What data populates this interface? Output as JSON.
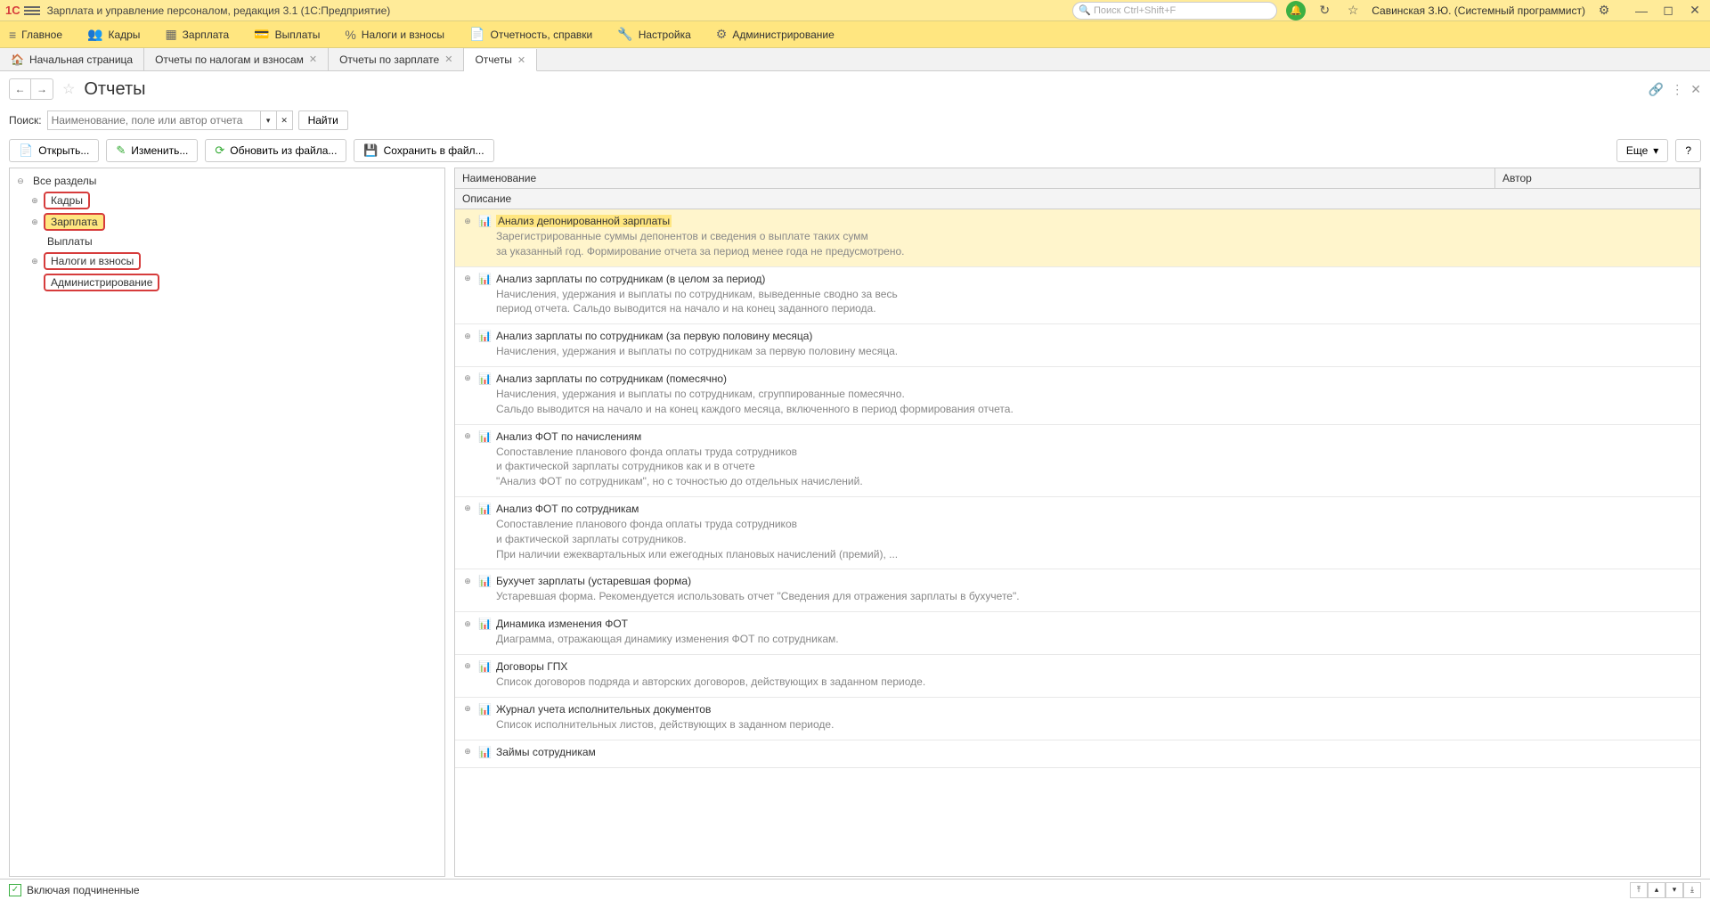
{
  "titlebar": {
    "logo": "1C",
    "app_title": "Зарплата и управление персоналом, редакция 3.1  (1С:Предприятие)",
    "search_placeholder": "Поиск Ctrl+Shift+F",
    "user": "Савинская З.Ю. (Системный программист)"
  },
  "mainmenu": [
    {
      "icon": "≡",
      "label": "Главное"
    },
    {
      "icon": "👥",
      "label": "Кадры"
    },
    {
      "icon": "▦",
      "label": "Зарплата"
    },
    {
      "icon": "💳",
      "label": "Выплаты"
    },
    {
      "icon": "%",
      "label": "Налоги и взносы"
    },
    {
      "icon": "📄",
      "label": "Отчетность, справки"
    },
    {
      "icon": "🔧",
      "label": "Настройка"
    },
    {
      "icon": "⚙",
      "label": "Администрирование"
    }
  ],
  "tabs": [
    {
      "icon": "🏠",
      "label": "Начальная страница",
      "closable": false
    },
    {
      "icon": "",
      "label": "Отчеты по налогам и взносам",
      "closable": true
    },
    {
      "icon": "",
      "label": "Отчеты по зарплате",
      "closable": true
    },
    {
      "icon": "",
      "label": "Отчеты",
      "closable": true,
      "active": true
    }
  ],
  "page": {
    "title": "Отчеты",
    "search_label": "Поиск:",
    "search_placeholder": "Наименование, поле или автор отчета",
    "find_button": "Найти"
  },
  "toolbar": {
    "open": "Открыть...",
    "edit": "Изменить...",
    "update": "Обновить из файла...",
    "save": "Сохранить в файл...",
    "more": "Еще"
  },
  "tree": {
    "root": "Все разделы",
    "items": [
      {
        "label": "Кадры",
        "highlighted": true,
        "expandable": true
      },
      {
        "label": "Зарплата",
        "highlighted": true,
        "selected": true,
        "expandable": true
      },
      {
        "label": "Выплаты",
        "highlighted": false,
        "expandable": false
      },
      {
        "label": "Налоги и взносы",
        "highlighted": true,
        "expandable": true
      },
      {
        "label": "Администрирование",
        "highlighted": true,
        "expandable": false
      }
    ]
  },
  "table_headers": {
    "name": "Наименование",
    "author": "Автор",
    "description": "Описание"
  },
  "reports": [
    {
      "title": "Анализ депонированной зарплаты",
      "desc": "Зарегистрированные суммы депонентов и сведения о выплате таких сумм\nза указанный год. Формирование отчета за период менее года не предусмотрено.",
      "selected": true
    },
    {
      "title": "Анализ зарплаты по сотрудникам (в целом за период)",
      "desc": "Начисления, удержания и выплаты по сотрудникам, выведенные сводно за весь\nпериод отчета. Сальдо выводится на начало и на конец заданного периода."
    },
    {
      "title": "Анализ зарплаты по сотрудникам (за первую половину месяца)",
      "desc": "Начисления, удержания и выплаты по сотрудникам за первую половину месяца."
    },
    {
      "title": "Анализ зарплаты по сотрудникам (помесячно)",
      "desc": "Начисления, удержания и выплаты по сотрудникам, сгруппированные помесячно.\nСальдо выводится на начало и на конец каждого месяца, включенного в период формирования отчета."
    },
    {
      "title": "Анализ ФОТ по начислениям",
      "desc": "Сопоставление планового фонда оплаты труда сотрудников\nи фактической зарплаты сотрудников как и в отчете\n\"Анализ ФОТ по сотрудникам\", но с точностью до отдельных начислений."
    },
    {
      "title": "Анализ ФОТ по сотрудникам",
      "desc": "Сопоставление планового фонда оплаты труда сотрудников\nи фактической зарплаты сотрудников.\nПри наличии ежеквартальных или ежегодных плановых начислений (премий), ..."
    },
    {
      "title": "Бухучет зарплаты (устаревшая форма)",
      "desc": "Устаревшая форма. Рекомендуется использовать отчет \"Сведения для отражения зарплаты в бухучете\"."
    },
    {
      "title": "Динамика изменения ФОТ",
      "desc": "Диаграмма, отражающая динамику изменения ФОТ по сотрудникам."
    },
    {
      "title": "Договоры ГПХ",
      "desc": "Список договоров подряда и авторских договоров, действующих в заданном периоде."
    },
    {
      "title": "Журнал учета исполнительных документов",
      "desc": "Список исполнительных листов, действующих в заданном периоде."
    },
    {
      "title": "Займы сотрудникам",
      "desc": ""
    }
  ],
  "footer": {
    "checkbox_label": "Включая подчиненные"
  }
}
